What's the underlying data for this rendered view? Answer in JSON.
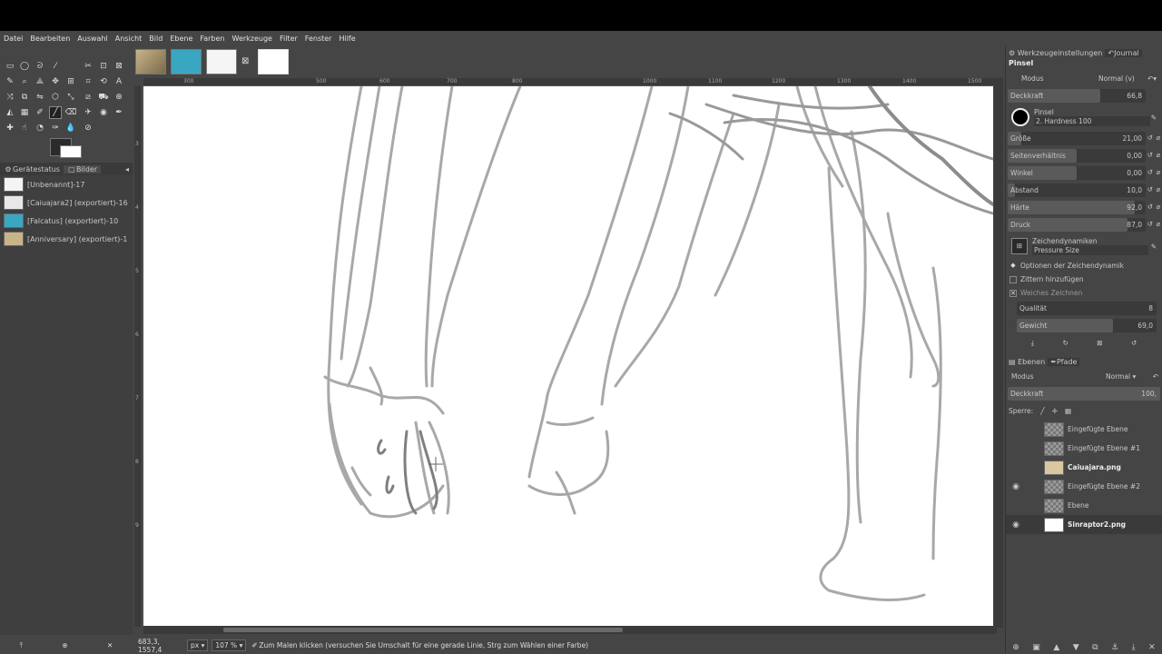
{
  "menu": [
    "Datei",
    "Bearbeiten",
    "Auswahl",
    "Ansicht",
    "Bild",
    "Ebene",
    "Farben",
    "Werkzeuge",
    "Filter",
    "Fenster",
    "Hilfe"
  ],
  "left_panel": {
    "tabs": [
      "Gerätestatus",
      "Bilder"
    ],
    "images": [
      {
        "label": "[Unbenannt]-17",
        "color": "#f4f4f4"
      },
      {
        "label": "[Caiuajara2] (exportiert)-16",
        "color": "#e8e8e8"
      },
      {
        "label": "[Falcatus] (exportiert)-10",
        "color": "#3aa7c2"
      },
      {
        "label": "[Anniversary] (exportiert)-1",
        "color": "#c9b48a"
      }
    ]
  },
  "rulers": {
    "h": [
      "300",
      "500",
      "600",
      "700",
      "800",
      "1000",
      "1100",
      "1200",
      "1300",
      "1400",
      "1500"
    ],
    "v": [
      "3",
      "4",
      "5",
      "6",
      "7",
      "8",
      "9",
      "1000",
      "1100"
    ]
  },
  "status": {
    "coords": "683,3, 1557,4",
    "unit": "px",
    "zoom": "107 %",
    "message": "Zum Malen klicken (versuchen Sie Umschalt für eine gerade Linie, Strg zum Wählen einer Farbe)"
  },
  "tool_options": {
    "tabs": [
      "Werkzeugeinstellungen",
      "Journal"
    ],
    "tool_name": "Pinsel",
    "modus_label": "Modus",
    "modus_value": "Normal (v)",
    "opacity": {
      "label": "Deckkraft",
      "value": "66,8",
      "fraction": 0.67
    },
    "brush_label": "Pinsel",
    "brush_name": "2. Hardness 100",
    "sliders": [
      {
        "label": "Größe",
        "value": "21,00",
        "fraction": 0.1
      },
      {
        "label": "Seitenverhältnis",
        "value": "0,00",
        "fraction": 0.5
      },
      {
        "label": "Winkel",
        "value": "0,00",
        "fraction": 0.5
      },
      {
        "label": "Abstand",
        "value": "10,0",
        "fraction": 0.05
      },
      {
        "label": "Härte",
        "value": "92,0",
        "fraction": 0.92
      },
      {
        "label": "Druck",
        "value": "87,0",
        "fraction": 0.87
      }
    ],
    "dynamics_label": "Zeichendynamiken",
    "dynamics_value": "Pressure Size",
    "checks": [
      {
        "label": "Optionen der Zeichendynamik",
        "mark": "◆"
      },
      {
        "label": "Zittern hinzufügen",
        "mark": ""
      },
      {
        "label": "Weiches Zeichnen",
        "mark": "✕"
      }
    ],
    "quality": {
      "label": "Qualität",
      "value": "8"
    },
    "weight": {
      "label": "Gewicht",
      "value": "69,0"
    }
  },
  "layers_panel": {
    "tabs": [
      "Ebenen",
      "Pfade"
    ],
    "modus_label": "Modus",
    "modus_value": "Normal",
    "opacity_label": "Deckkraft",
    "opacity_value": "100,",
    "lock_label": "Sperre:",
    "layers": [
      {
        "name": "Eingefügte Ebene",
        "visible": false,
        "bold": false
      },
      {
        "name": "Eingefügte Ebene #1",
        "visible": false,
        "bold": false
      },
      {
        "name": "Caiuajara.png",
        "visible": false,
        "bold": true
      },
      {
        "name": "Eingefügte Ebene #2",
        "visible": true,
        "bold": false
      },
      {
        "name": "Ebene",
        "visible": false,
        "bold": false
      },
      {
        "name": "Sinraptor2.png",
        "visible": true,
        "bold": true
      }
    ]
  }
}
